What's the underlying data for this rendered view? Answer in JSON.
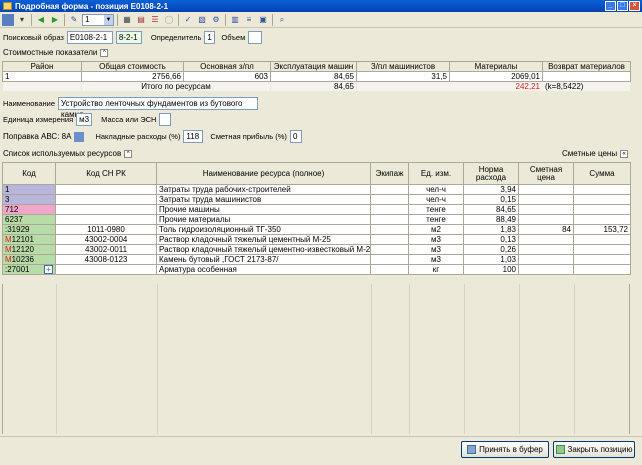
{
  "window": {
    "title": "Подробная форма - позиция Е0108-2-1",
    "min": "_",
    "max": "□",
    "close": "×"
  },
  "toolbar": {
    "combo_value": "1"
  },
  "search": {
    "label": "Поисковый образ",
    "value1": "Е0108-2-1",
    "value2": "8-2-1",
    "determinant_label": "Определитель",
    "determinant_value": "1",
    "volume_label": "Объем",
    "volume_value": ""
  },
  "cost": {
    "title": "Стоимостные показатели",
    "headers": [
      "Район",
      "Общая стоимость",
      "Основная з/пл",
      "Эксплуатация машин",
      "З/пл машинистов",
      "Материалы",
      "Возврат материалов"
    ],
    "row": [
      "1",
      "2756,66",
      "603",
      "84,65",
      "31,5",
      "2069,01",
      ""
    ],
    "total_label": "Итого по ресурсам",
    "total_machines": "84,65",
    "total_return": "242,21",
    "total_coef": "(k=8,5422)"
  },
  "name": {
    "label": "Наименование",
    "value": "Устройство ленточных фундаментов из бутового камня"
  },
  "units": {
    "label": "Единица измерения",
    "value": "м3",
    "mass_label": "Масса или ЭСН",
    "mass_value": ""
  },
  "abc": {
    "label": "Поправка АВС: 8А",
    "overhead_label": "Накладные расходы (%)",
    "overhead_value": "118",
    "profit_label": "Сметная прибыль (%)",
    "profit_value": "0"
  },
  "resources": {
    "title": "Список используемых ресурсов",
    "prices_label": "Сметные цены",
    "headers": [
      "Код",
      "Код СН РК",
      "Наименование ресурса (полное)",
      "Экипаж",
      "Ед. изм.",
      "Норма расхода",
      "Сметная цена",
      "Сумма"
    ],
    "rows": [
      {
        "code": "1",
        "sn": "",
        "name": "Затраты труда рабочих-строителей",
        "crew": "",
        "unit": "чел-ч",
        "norm": "3,94",
        "price": "",
        "sum": ""
      },
      {
        "code": "3",
        "sn": "",
        "name": "Затраты труда машинистов",
        "crew": "",
        "unit": "чел-ч",
        "norm": "0,15",
        "price": "",
        "sum": ""
      },
      {
        "code": "712",
        "sn": "",
        "name": "Прочие машины",
        "crew": "",
        "unit": "тенге",
        "norm": "84,65",
        "price": "",
        "sum": ""
      },
      {
        "code": "6237",
        "sn": "",
        "name": "Прочие материалы",
        "crew": "",
        "unit": "тенге",
        "norm": "88,49",
        "price": "",
        "sum": ""
      },
      {
        "code": ":31929",
        "sn": "1011-0980",
        "name": "Толь гидроизоляционный ТГ-350",
        "crew": "",
        "unit": "м2",
        "norm": "1,83",
        "price": "84",
        "sum": "153,72"
      },
      {
        "code": "М12101",
        "sn": "43002-0004",
        "name": "Раствор кладочный тяжелый цементный М-25",
        "crew": "",
        "unit": "м3",
        "norm": "0,13",
        "price": "",
        "sum": ""
      },
      {
        "code": "М12120",
        "sn": "43002-0011",
        "name": "Раствор кладочный тяжелый цементно-известковый М-25",
        "crew": "",
        "unit": "м3",
        "norm": "0,26",
        "price": "",
        "sum": ""
      },
      {
        "code": "М10236",
        "sn": "43008-0123",
        "name": "Камень бутовый ,ГОСТ 2173-87/",
        "crew": "",
        "unit": "м3",
        "norm": "1,03",
        "price": "",
        "sum": ""
      },
      {
        "code": ":27001",
        "sn": "",
        "name": "Арматура особенная",
        "crew": "",
        "unit": "кг",
        "norm": "100",
        "price": "",
        "sum": ""
      }
    ]
  },
  "buttons": {
    "accept": "Принять в буфер",
    "close": "Закрыть позицию"
  },
  "colors": {
    "labor": "#b9b6dc",
    "machine": "#f0a6c9",
    "material": "#b8dca8",
    "red": "#d42020"
  }
}
